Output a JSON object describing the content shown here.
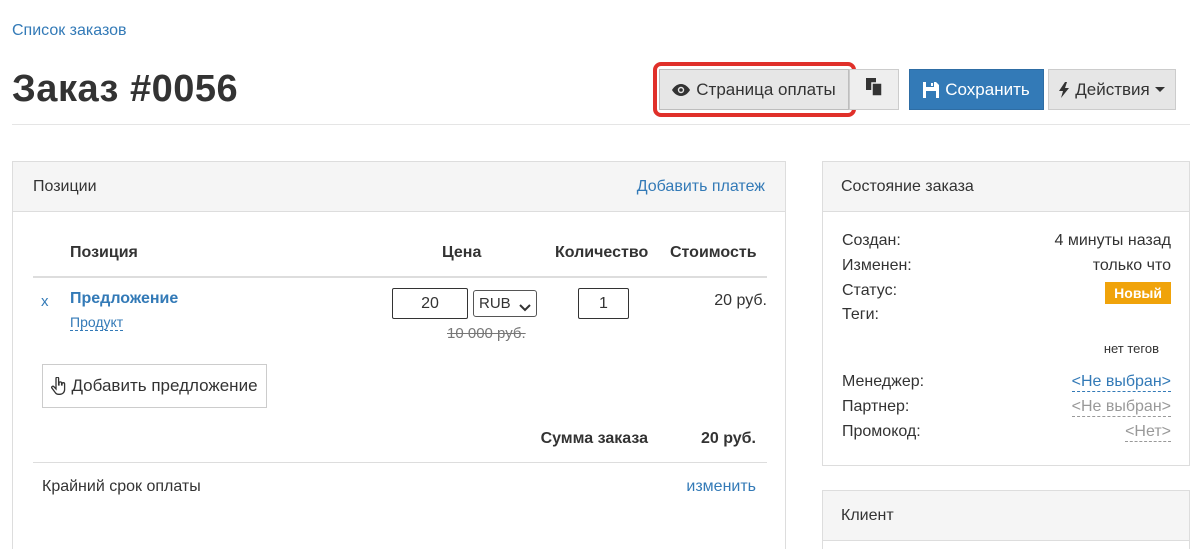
{
  "breadcrumb": "Список заказов",
  "page_title": "Заказ #0056",
  "toolbar": {
    "preview_label": "Страница оплаты",
    "save_label": "Сохранить",
    "actions_label": "Действия",
    "accent_color": "#337ab7",
    "highlight_color": "#e0302a"
  },
  "items_panel": {
    "title": "Позиции",
    "add_payment": "Добавить платеж",
    "columns": {
      "item": "Позиция",
      "price": "Цена",
      "qty": "Количество",
      "cost": "Стоимость"
    },
    "rows": [
      {
        "remove": "x",
        "name": "Предложение",
        "type": "Продукт",
        "price": "20",
        "currency": "RUB",
        "old_price": "10 000 руб.",
        "qty": "1",
        "cost": "20 руб."
      }
    ],
    "add_offer": "Добавить предложение",
    "total_label": "Сумма заказа",
    "total_value": "20 руб.",
    "deadline_label": "Крайний срок оплаты",
    "deadline_link": "изменить"
  },
  "status_panel": {
    "title": "Состояние заказа",
    "created_label": "Создан:",
    "created_value": "4 минуты назад",
    "modified_label": "Изменен:",
    "modified_value": "только что",
    "status_label": "Статус:",
    "status_value": "Новый",
    "status_color": "#f0a30a",
    "tags_label": "Теги:",
    "tags_value": "нет тегов",
    "manager_label": "Менеджер:",
    "manager_value": "<Не выбран>",
    "partner_label": "Партнер:",
    "partner_value": "<Не выбран>",
    "promo_label": "Промокод:",
    "promo_value": "<Нет>"
  },
  "client_panel": {
    "title": "Клиент"
  }
}
